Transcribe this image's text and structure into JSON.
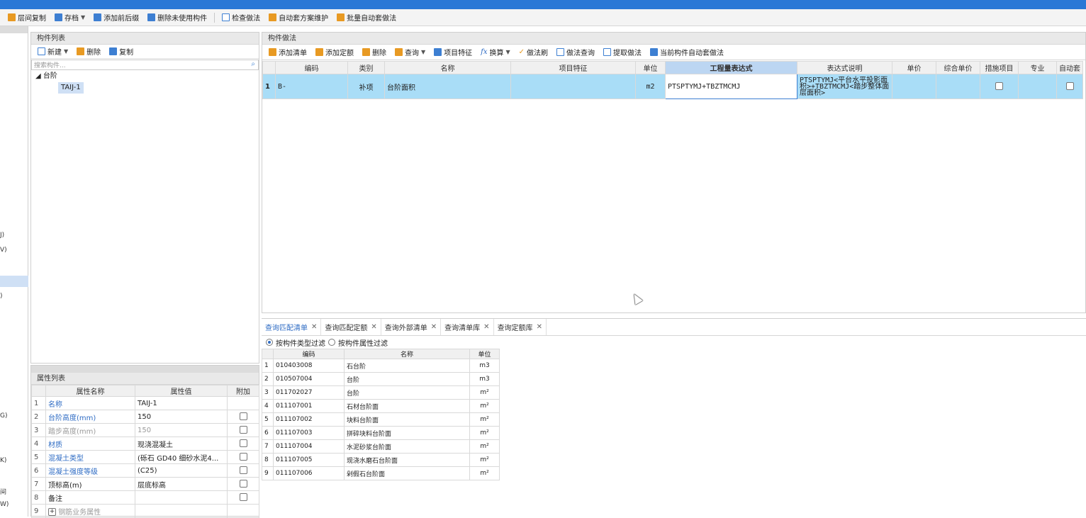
{
  "toolbar": {
    "items": [
      {
        "label": "层间复制"
      },
      {
        "label": "存档",
        "dropdown": true
      },
      {
        "label": "添加前后缀"
      },
      {
        "label": "删除未使用构件"
      },
      {
        "label": "检查做法"
      },
      {
        "label": "自动套方案维护"
      },
      {
        "label": "批量自动套做法"
      }
    ]
  },
  "left_strip": {
    "items": [
      "J)",
      "V)",
      ")",
      "G)",
      "K)",
      "间",
      "W)"
    ]
  },
  "component_list": {
    "title": "构件列表",
    "tools": {
      "new": "新建",
      "delete": "删除",
      "copy": "复制"
    },
    "search_placeholder": "搜索构件...",
    "tree": {
      "root": "台阶",
      "child": "TAIJ-1"
    }
  },
  "property_list": {
    "title": "属性列表",
    "headers": {
      "name": "属性名称",
      "value": "属性值",
      "extra": "附加"
    },
    "rows": [
      {
        "num": "1",
        "name": "名称",
        "value": "TAIJ-1",
        "checkbox": false
      },
      {
        "num": "2",
        "name": "台阶高度(mm)",
        "value": "150",
        "checkbox": true
      },
      {
        "num": "3",
        "name": "踏步高度(mm)",
        "value": "150",
        "checkbox": true
      },
      {
        "num": "4",
        "name": "材质",
        "value": "现浇混凝土",
        "checkbox": true
      },
      {
        "num": "5",
        "name": "混凝土类型",
        "value": "(砾石 GD40 细砂水泥4...",
        "checkbox": true
      },
      {
        "num": "6",
        "name": "混凝土强度等级",
        "value": "(C25)",
        "checkbox": true
      },
      {
        "num": "7",
        "name": "顶标高(m)",
        "value": "层底标高",
        "checkbox": true
      },
      {
        "num": "8",
        "name": "备注",
        "value": "",
        "checkbox": true
      },
      {
        "num": "9",
        "name": "钢筋业务属性",
        "value": "",
        "checkbox": false
      }
    ]
  },
  "method_panel": {
    "title": "构件做法",
    "tools": {
      "add_list": "添加清单",
      "add_quota": "添加定额",
      "delete": "删除",
      "query": "查询",
      "item_feature": "项目特征",
      "convert": "换算",
      "brush": "做法刷",
      "method_query": "做法查询",
      "extract": "提取做法",
      "auto_apply": "当前构件自动套做法"
    },
    "headers": {
      "code": "编码",
      "category": "类别",
      "name": "名称",
      "feature": "项目特征",
      "unit": "单位",
      "expr": "工程量表达式",
      "expr_desc": "表达式说明",
      "price": "单价",
      "total_price": "综合单价",
      "measure": "措施项目",
      "major": "专业",
      "auto": "自动套"
    },
    "rows": [
      {
        "num": "1",
        "code": "B-",
        "category": "补项",
        "name": "台阶面积",
        "feature": "",
        "unit": "m2",
        "expr": "PTSPTYMJ+TBZTMCMJ",
        "expr_desc": "PTSPTYMJ<平台水平投影面积>+TBZTMCMJ<踏步整体面层面积>",
        "price": "",
        "total_price": "",
        "measure_checked": false,
        "major": "",
        "auto_checked": false
      }
    ]
  },
  "query_panel": {
    "tabs": [
      "查询匹配清单",
      "查询匹配定额",
      "查询外部清单",
      "查询清单库",
      "查询定额库"
    ],
    "active_tab": 0,
    "filters": {
      "by_type": "按构件类型过滤",
      "by_attr": "按构件属性过滤",
      "selected": "by_type"
    },
    "headers": {
      "code": "编码",
      "name": "名称",
      "unit": "单位"
    },
    "rows": [
      {
        "num": "1",
        "code": "010403008",
        "name": "石台阶",
        "unit": "m3"
      },
      {
        "num": "2",
        "code": "010507004",
        "name": "台阶",
        "unit": "m3"
      },
      {
        "num": "3",
        "code": "011702027",
        "name": "台阶",
        "unit": "m²"
      },
      {
        "num": "4",
        "code": "011107001",
        "name": "石材台阶面",
        "unit": "m²"
      },
      {
        "num": "5",
        "code": "011107002",
        "name": "块料台阶面",
        "unit": "m²"
      },
      {
        "num": "6",
        "code": "011107003",
        "name": "拼碎块料台阶面",
        "unit": "m²"
      },
      {
        "num": "7",
        "code": "011107004",
        "name": "水泥砂浆台阶面",
        "unit": "m²"
      },
      {
        "num": "8",
        "code": "011107005",
        "name": "现浇水磨石台阶面",
        "unit": "m²"
      },
      {
        "num": "9",
        "code": "011107006",
        "name": "剁假石台阶面",
        "unit": "m²"
      }
    ]
  }
}
